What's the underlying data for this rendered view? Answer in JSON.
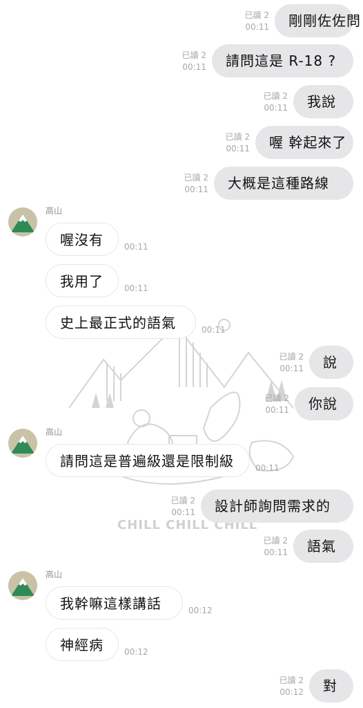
{
  "read_label": "已讀 2",
  "sender_name": "高山",
  "colors": {
    "outgoing_bubble": "#e6e6e8",
    "incoming_bubble": "#ffffff",
    "avatar_bg": "#c9c2a7",
    "avatar_mountain": "#2e8b57"
  },
  "watermark": {
    "text": "CHILL CHILL CHILL"
  },
  "messages": [
    {
      "dir": "out",
      "text": "剛剛佐佐問",
      "time": "00:11"
    },
    {
      "dir": "out",
      "text": "請問這是 R-18 ?",
      "time": "00:11"
    },
    {
      "dir": "out",
      "text": "我說",
      "time": "00:11"
    },
    {
      "dir": "out",
      "text": "喔 幹起來了",
      "time": "00:11"
    },
    {
      "dir": "out",
      "text": "大概是這種路線",
      "time": "00:11"
    },
    {
      "dir": "in",
      "text": "喔沒有",
      "time": "00:11"
    },
    {
      "dir": "in",
      "text": "我用了",
      "time": "00:11"
    },
    {
      "dir": "in",
      "text": "史上最正式的語氣",
      "time": "00:11"
    },
    {
      "dir": "out",
      "text": "說",
      "time": "00:11"
    },
    {
      "dir": "out",
      "text": "你說",
      "time": "00:11"
    },
    {
      "dir": "in",
      "text": "請問這是普遍級還是限制級",
      "time": "00:11"
    },
    {
      "dir": "out",
      "text": "設計師詢問需求的",
      "time": "00:11"
    },
    {
      "dir": "out",
      "text": "語氣",
      "time": "00:11"
    },
    {
      "dir": "in",
      "text": "我幹嘛這樣講話",
      "time": "00:12"
    },
    {
      "dir": "in",
      "text": "神經病",
      "time": "00:12"
    },
    {
      "dir": "out",
      "text": "對",
      "time": "00:12"
    }
  ]
}
